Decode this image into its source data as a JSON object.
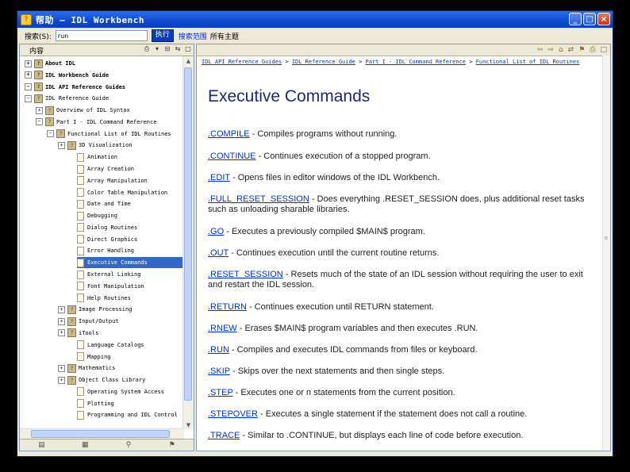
{
  "window": {
    "title": "帮助 — IDL Workbench",
    "controls": [
      "_",
      "□",
      "×"
    ]
  },
  "toolbar": {
    "search_label": "搜索(S):",
    "search_value": "run",
    "go_label": "执行",
    "scope_link": "搜索范围",
    "scope_value": "所有主题"
  },
  "left_pane": {
    "title": "内容",
    "tree": [
      {
        "label": "About IDL",
        "level": 0,
        "expander": "+",
        "icon": "book",
        "bold": true
      },
      {
        "label": "IDL Workbench Guide",
        "level": 0,
        "expander": "+",
        "icon": "book",
        "bold": true
      },
      {
        "label": "IDL API Reference Guides",
        "level": 0,
        "expander": "−",
        "icon": "book",
        "bold": true
      },
      {
        "label": "IDL Reference Guide",
        "level": 1,
        "expander": "−",
        "icon": "book",
        "bold": false
      },
      {
        "label": "Overview of IDL Syntax",
        "level": 2,
        "expander": "+",
        "icon": "book",
        "bold": false
      },
      {
        "label": "Part I - IDL Command Reference",
        "level": 2,
        "expander": "−",
        "icon": "book",
        "bold": false
      },
      {
        "label": "Functional List of IDL Routines",
        "level": 3,
        "expander": "−",
        "icon": "book",
        "bold": false
      },
      {
        "label": "3D Visualization",
        "level": 4,
        "expander": "+",
        "icon": "book",
        "bold": false
      },
      {
        "label": "Animation",
        "level": 5,
        "expander": "",
        "icon": "page",
        "bold": false
      },
      {
        "label": "Array Creation",
        "level": 5,
        "expander": "",
        "icon": "page",
        "bold": false
      },
      {
        "label": "Array Manipulation",
        "level": 5,
        "expander": "",
        "icon": "page",
        "bold": false
      },
      {
        "label": "Color Table Manipulation",
        "level": 5,
        "expander": "",
        "icon": "page",
        "bold": false
      },
      {
        "label": "Date and Time",
        "level": 5,
        "expander": "",
        "icon": "page",
        "bold": false
      },
      {
        "label": "Debugging",
        "level": 5,
        "expander": "",
        "icon": "page",
        "bold": false
      },
      {
        "label": "Dialog Routines",
        "level": 5,
        "expander": "",
        "icon": "page",
        "bold": false
      },
      {
        "label": "Direct Graphics",
        "level": 5,
        "expander": "",
        "icon": "page",
        "bold": false
      },
      {
        "label": "Error Handling",
        "level": 5,
        "expander": "",
        "icon": "page",
        "bold": false
      },
      {
        "label": "Executive Commands",
        "level": 5,
        "expander": "",
        "icon": "page",
        "bold": false,
        "selected": true
      },
      {
        "label": "External Linking",
        "level": 5,
        "expander": "",
        "icon": "page",
        "bold": false
      },
      {
        "label": "Font Manipulation",
        "level": 5,
        "expander": "",
        "icon": "page",
        "bold": false
      },
      {
        "label": "Help Routines",
        "level": 5,
        "expander": "",
        "icon": "page",
        "bold": false
      },
      {
        "label": "Image Processing",
        "level": 4,
        "expander": "+",
        "icon": "book",
        "bold": false
      },
      {
        "label": "Input/Output",
        "level": 4,
        "expander": "+",
        "icon": "book",
        "bold": false
      },
      {
        "label": "iTools",
        "level": 4,
        "expander": "+",
        "icon": "book",
        "bold": false
      },
      {
        "label": "Language Catalogs",
        "level": 5,
        "expander": "",
        "icon": "page",
        "bold": false
      },
      {
        "label": "Mapping",
        "level": 5,
        "expander": "",
        "icon": "page",
        "bold": false
      },
      {
        "label": "Mathematics",
        "level": 4,
        "expander": "+",
        "icon": "book",
        "bold": false
      },
      {
        "label": "Object Class Library",
        "level": 4,
        "expander": "+",
        "icon": "book",
        "bold": false
      },
      {
        "label": "Operating System Access",
        "level": 5,
        "expander": "",
        "icon": "page",
        "bold": false
      },
      {
        "label": "Plotting",
        "level": 5,
        "expander": "",
        "icon": "page",
        "bold": false
      },
      {
        "label": "Programming and IDL Control",
        "level": 5,
        "expander": "",
        "icon": "page",
        "bold": false
      }
    ],
    "bottom_tabs": [
      "contents-tab-icon",
      "index-tab-icon",
      "search-tab-icon",
      "bookmarks-tab-icon"
    ]
  },
  "right_pane": {
    "breadcrumbs": [
      "IDL API Reference Guides",
      "IDL Reference Guide",
      "Part I - IDL Command Reference",
      "Functional List of IDL Routines"
    ],
    "heading": "Executive Commands",
    "commands": [
      {
        "name": ".COMPILE",
        "desc": " - Compiles programs without running."
      },
      {
        "name": ".CONTINUE",
        "desc": " - Continues execution of a stopped program."
      },
      {
        "name": ".EDIT",
        "desc": " - Opens files in editor windows of the IDL Workbench."
      },
      {
        "name": ".FULL_RESET_SESSION",
        "desc": " - Does everything .RESET_SESSION does, plus additional reset tasks such as unloading sharable libraries."
      },
      {
        "name": ".GO",
        "desc": " - Executes a previously compiled $MAIN$ program."
      },
      {
        "name": ".OUT",
        "desc": " - Continues execution until the current routine returns."
      },
      {
        "name": ".RESET_SESSION",
        "desc": " - Resets much of the state of an IDL session without requiring the user to exit and restart the IDL session."
      },
      {
        "name": ".RETURN",
        "desc": " - Continues execution until RETURN statement."
      },
      {
        "name": ".RNEW",
        "desc": " - Erases $MAIN$ program variables and then executes .RUN."
      },
      {
        "name": ".RUN",
        "desc": " - Compiles and executes IDL commands from files or keyboard."
      },
      {
        "name": ".SKIP",
        "desc": " - Skips over the next statements and then single steps."
      },
      {
        "name": ".STEP",
        "desc": " - Executes one or n statements from the current position."
      },
      {
        "name": ".STEPOVER",
        "desc": " - Executes a single statement if the statement does not call a routine."
      },
      {
        "name": ".TRACE",
        "desc": " - Similar to .CONTINUE, but displays each line of code before execution."
      }
    ]
  }
}
